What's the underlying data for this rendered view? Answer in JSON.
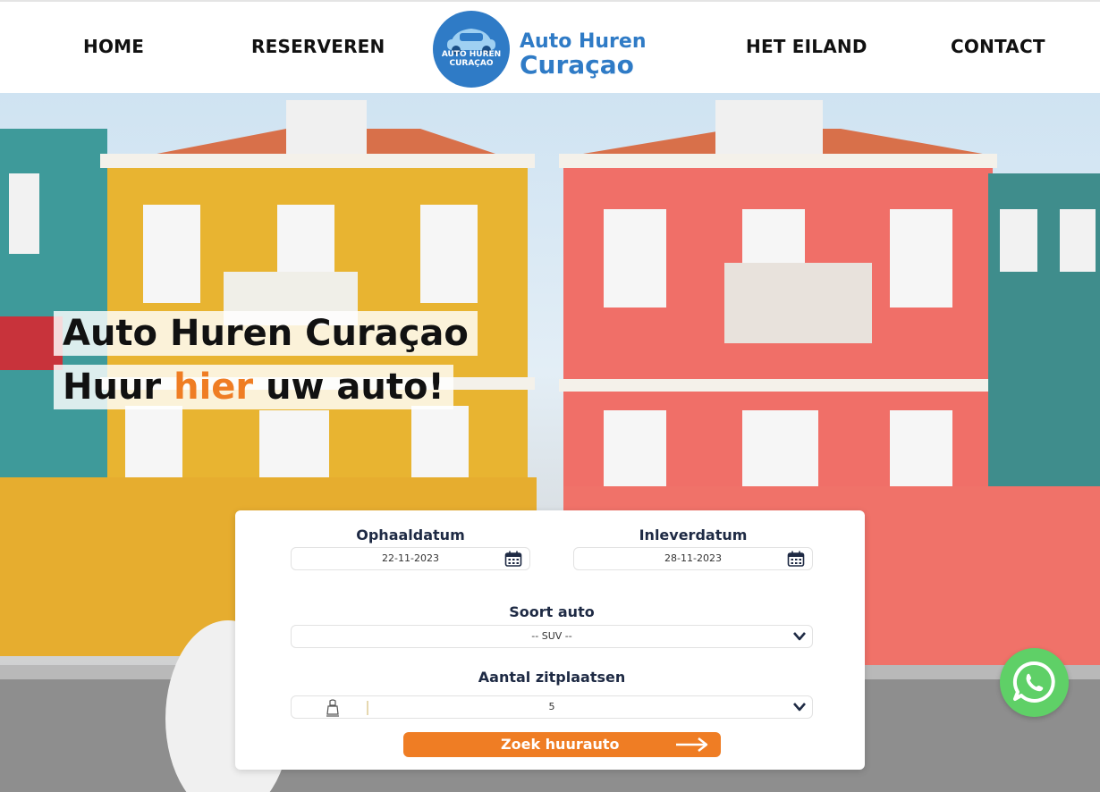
{
  "nav": {
    "items": [
      {
        "label": "HOME"
      },
      {
        "label": "RESERVEREN"
      },
      {
        "label": "HET EILAND"
      },
      {
        "label": "CONTACT"
      }
    ],
    "logo": {
      "badge_text": "AUTO HUREN CURAÇAO",
      "title_line1": "Auto Huren",
      "title_line2": "Curaçao"
    }
  },
  "hero": {
    "headline_line1": "Auto Huren Curaçao",
    "headline_line2_pre": "Huur ",
    "headline_line2_accent": "hier",
    "headline_line2_post": " uw auto!"
  },
  "search": {
    "pickup_label": "Ophaaldatum",
    "pickup_value": "22-11-2023",
    "return_label": "Inleverdatum",
    "return_value": "28-11-2023",
    "car_type_label": "Soort auto",
    "car_type_value": "-- SUV --",
    "seats_label": "Aantal zitplaatsen",
    "seats_value": "5",
    "button_label": "Zoek huurauto"
  },
  "colors": {
    "brand_blue": "#2f7bc6",
    "accent_orange": "#ef7d24",
    "whatsapp_green": "#5fd067",
    "label_navy": "#1e2a44"
  },
  "icons": [
    "calendar-icon",
    "chevron-down-icon",
    "car-seat-icon",
    "arrow-right-icon",
    "whatsapp-icon"
  ]
}
